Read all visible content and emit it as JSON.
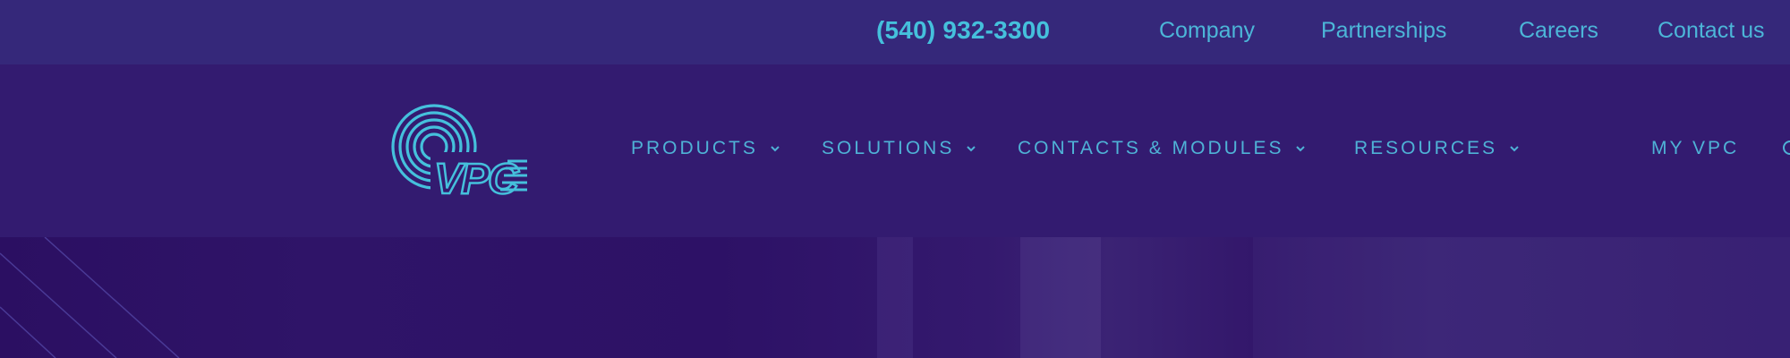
{
  "topbar": {
    "phone": "(540) 932-3300",
    "links": [
      "Company",
      "Partnerships",
      "Careers",
      "Contact us"
    ]
  },
  "nav": {
    "items": [
      {
        "label": "PRODUCTS",
        "has_dropdown": true
      },
      {
        "label": "SOLUTIONS",
        "has_dropdown": true
      },
      {
        "label": "CONTACTS & MODULES",
        "has_dropdown": true
      },
      {
        "label": "RESOURCES",
        "has_dropdown": true
      },
      {
        "label": "MY VPC",
        "has_dropdown": false
      }
    ]
  },
  "logo": {
    "text": "VPC"
  },
  "colors": {
    "accent": "#45c0dc",
    "topbar_bg": "#35287a",
    "navbar_bg": "#331b70",
    "hero_bg": "#2d1166"
  }
}
